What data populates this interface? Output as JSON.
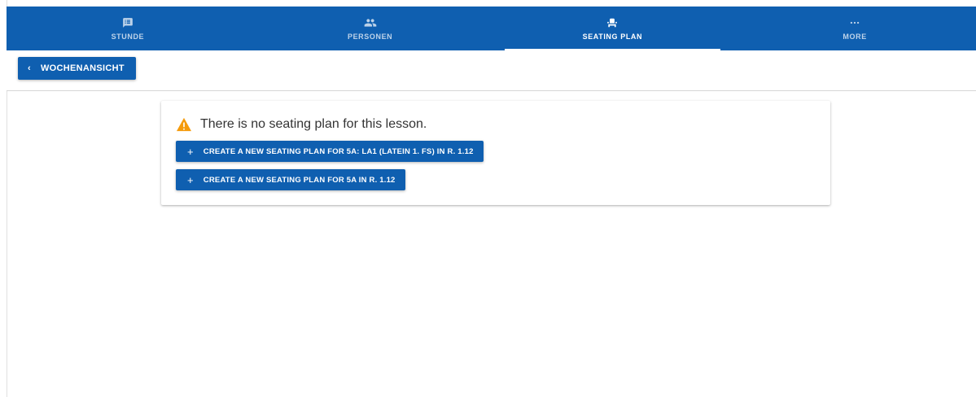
{
  "tabs": [
    {
      "label": "STUNDE",
      "icon": "lesson-note-icon",
      "active": false
    },
    {
      "label": "PERSONEN",
      "icon": "people-icon",
      "active": false
    },
    {
      "label": "SEATING PLAN",
      "icon": "seat-icon",
      "active": true
    },
    {
      "label": "MORE",
      "icon": "more-dots-icon",
      "active": false
    }
  ],
  "toolbar": {
    "back_label": "WOCHENANSICHT",
    "back_icon": "chevron-left-icon"
  },
  "notice": {
    "icon": "warning-icon",
    "message": "There is no seating plan for this lesson.",
    "actions": [
      {
        "label": "CREATE A NEW SEATING PLAN FOR 5A: LA1 (LATEIN 1. FS) IN R. 1.12",
        "icon": "plus-icon"
      },
      {
        "label": "CREATE A NEW SEATING PLAN FOR 5A IN R. 1.12",
        "icon": "plus-icon"
      }
    ]
  },
  "colors": {
    "primary": "#0f5fb0",
    "warning": "#f59b0c"
  }
}
